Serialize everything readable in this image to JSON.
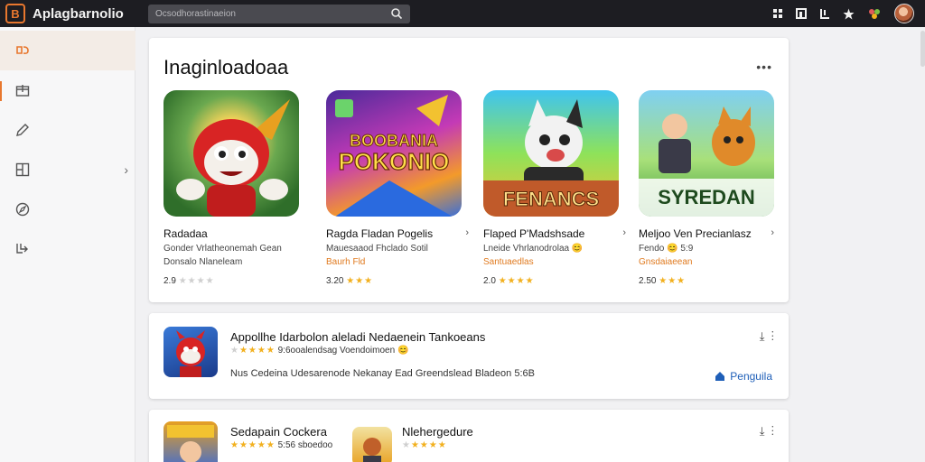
{
  "app": {
    "title": "Aplagbarnolio",
    "logo_glyph": "B"
  },
  "search": {
    "placeholder": "Ocsodhorastinaeion"
  },
  "header_icons": [
    "share-icon",
    "bookmark-icon",
    "export-icon",
    "star-icon",
    "gift-icon"
  ],
  "sidebar": {
    "items": [
      {
        "icon": "games-icon",
        "active": true
      },
      {
        "icon": "store-icon",
        "selected": true
      },
      {
        "icon": "pen-icon"
      },
      {
        "icon": "layout-icon",
        "has_chevron": true
      },
      {
        "icon": "compass-icon"
      },
      {
        "icon": "library-icon"
      }
    ]
  },
  "featured": {
    "title": "Inaginloadoaa",
    "more": "•••",
    "games": [
      {
        "name": "Radadaa",
        "art_text": "",
        "sub1": "Gonder Vrlatheonemah Gean",
        "sub2": "Donsalo Nlaneleam",
        "sub2_orange": false,
        "rating_value": "2.9",
        "stars": 0,
        "arrow": ""
      },
      {
        "name": "Ragda Fladan Pogelis",
        "art_text": "POKONIO",
        "art_top": "BOOBANIA",
        "sub1": "Mauesaaod Fhclado Sotil",
        "sub2": "Baurh Fld",
        "sub2_orange": true,
        "rating_value": "3.20",
        "stars": 3,
        "arrow": "›"
      },
      {
        "name": "Flaped P'Madshsade",
        "art_text": "FENANCS",
        "sub1": "Lneide Vhrlanodrolaa 😊",
        "sub2": "Santuaedlas",
        "sub2_orange": true,
        "rating_value": "2.0",
        "stars": 4,
        "arrow": "›"
      },
      {
        "name": "Meljoo Ven Precianlasz",
        "art_text": "SYREDAN",
        "sub1": "Fendo 😊 5:9",
        "sub2": "Gnsdaiaeean",
        "sub2_orange": true,
        "rating_value": "2.50",
        "stars": 3,
        "arrow": "›"
      }
    ]
  },
  "list": [
    {
      "title": "Appollhe Idarbolon aleladi Nedaenein Tankoeans",
      "rating": "9:6ooalendsag Voendoimoen 😊",
      "stars": 5,
      "desc": "Nus Cedeina Udesarenode Nekanay Ead Greendslead Bladeon 5:6B",
      "action_label": "Penguila",
      "download_glyph": "⤓",
      "menu_glyph": "⋮"
    },
    {
      "title": "Sedapain Cockera",
      "rating": "5:56 sboedoo",
      "stars": 5,
      "title2": "Nlehergedure",
      "stars2": 4,
      "download_glyph": "⤓",
      "menu_glyph": "⋮"
    }
  ],
  "colors": {
    "accent": "#e8772e",
    "link": "#1f5fb8",
    "topbar": "#1d1d22",
    "star": "#f2b01e"
  }
}
